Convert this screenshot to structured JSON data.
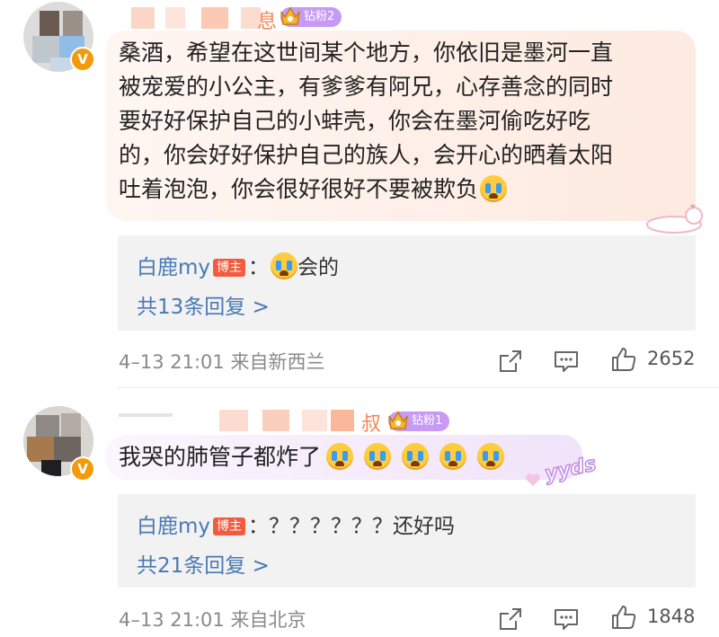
{
  "comments": [
    {
      "fan_badge": "钻粉2",
      "text": "桑酒，希望在这世间某个地方，你依旧是墨河一直\n被宠爱的小公主，有爹爹有阿兄，心存善念的同时\n要好好保护自己的小蚌壳，你会在墨河偷吃好吃\n的，你会好好保护自己的族人，会开心的晒着太阳\n吐着泡泡，你会很好很好不要被欺负",
      "reply": {
        "author": "白鹿my",
        "author_badge": "博主",
        "separator": "：",
        "text": "会的",
        "more_label": "共13条回复 >"
      },
      "time": "4–13 21:01",
      "location": "来自新西兰",
      "like_count": "2652"
    },
    {
      "fan_badge": "钻粉1",
      "text": "我哭的肺管子都炸了",
      "sticker_text": "yyds",
      "reply": {
        "author": "白鹿my",
        "author_badge": "博主",
        "separator": "：",
        "text": "？？？？？？还好吗",
        "more_label": "共21条回复 >"
      },
      "time": "4–13 21:01",
      "location": "来自北京",
      "like_count": "1848"
    }
  ],
  "icons": {
    "share": "share-icon",
    "comment": "comment-icon",
    "like": "thumbs-up-icon"
  },
  "colors": {
    "link": "#4a78b4",
    "host_badge": "#f25b3e",
    "fan_badge": "#c79bf5",
    "bubble_1": "#fdeae0",
    "bubble_2": "#f4e8fb"
  }
}
